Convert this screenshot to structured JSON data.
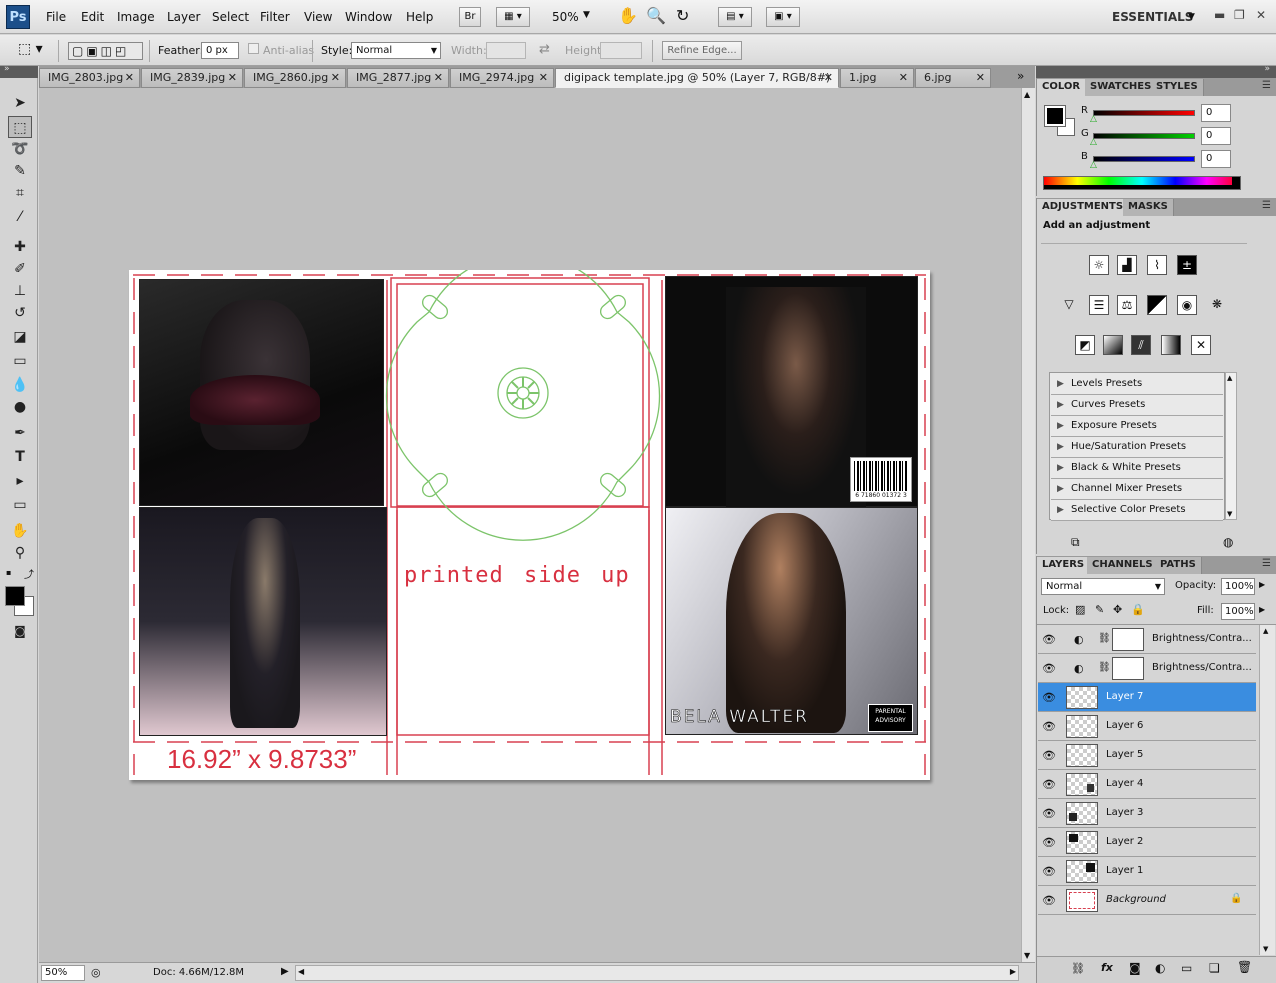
{
  "app": {
    "logo": "Ps",
    "workspace": "ESSENTIALS",
    "zoom_display": "50%",
    "bridge_label": "Br"
  },
  "menu": [
    "File",
    "Edit",
    "Image",
    "Layer",
    "Select",
    "Filter",
    "View",
    "Window",
    "Help"
  ],
  "options": {
    "feather_label": "Feather:",
    "feather_value": "0 px",
    "antialias_label": "Anti-alias",
    "style_label": "Style:",
    "style_value": "Normal",
    "width_label": "Width:",
    "height_label": "Height:",
    "refine_edge": "Refine Edge..."
  },
  "tabs": [
    {
      "label": "IMG_2803.jpg"
    },
    {
      "label": "IMG_2839.jpg"
    },
    {
      "label": "IMG_2860.jpg"
    },
    {
      "label": "IMG_2877.jpg"
    },
    {
      "label": "IMG_2974.jpg"
    },
    {
      "label": "digipack template.jpg @ 50% (Layer 7, RGB/8#) *"
    },
    {
      "label": "1.jpg"
    },
    {
      "label": "6.jpg"
    }
  ],
  "tab_overflow": "»",
  "document": {
    "printed_text": "printed side up",
    "dimension_text": "16.92” x 9.8733”",
    "artist_text": "BELA WALTER",
    "advisory_text": "PARENTAL ADVISORY",
    "barcode_text": "6 71860 01372 3"
  },
  "status": {
    "zoom": "50%",
    "doc": "Doc: 4.66M/12.8M"
  },
  "color_panel": {
    "tabs": [
      "COLOR",
      "SWATCHES",
      "STYLES"
    ],
    "channels": [
      {
        "label": "R",
        "value": "0",
        "color": "#ff0000"
      },
      {
        "label": "G",
        "value": "0",
        "color": "#00c000"
      },
      {
        "label": "B",
        "value": "0",
        "color": "#0000ff"
      }
    ]
  },
  "adjustments_panel": {
    "tabs": [
      "ADJUSTMENTS",
      "MASKS"
    ],
    "heading": "Add an adjustment",
    "presets": [
      "Levels Presets",
      "Curves Presets",
      "Exposure Presets",
      "Hue/Saturation Presets",
      "Black & White Presets",
      "Channel Mixer Presets",
      "Selective Color Presets"
    ]
  },
  "layers_panel": {
    "tabs": [
      "LAYERS",
      "CHANNELS",
      "PATHS"
    ],
    "blend_mode": "Normal",
    "opacity_label": "Opacity:",
    "opacity_value": "100%",
    "lock_label": "Lock:",
    "fill_label": "Fill:",
    "fill_value": "100%",
    "layers": [
      {
        "name": "Brightness/Contra...",
        "type": "adjustment"
      },
      {
        "name": "Brightness/Contra...",
        "type": "adjustment"
      },
      {
        "name": "Layer 7",
        "selected": true
      },
      {
        "name": "Layer 6"
      },
      {
        "name": "Layer 5"
      },
      {
        "name": "Layer 4"
      },
      {
        "name": "Layer 3"
      },
      {
        "name": "Layer 2"
      },
      {
        "name": "Layer 1"
      },
      {
        "name": "Background",
        "italic": true
      }
    ],
    "footer_icons": [
      "link-icon",
      "fx-icon",
      "mask-icon",
      "adjustment-icon",
      "folder-icon",
      "new-layer-icon",
      "trash-icon"
    ]
  }
}
